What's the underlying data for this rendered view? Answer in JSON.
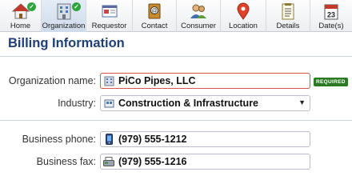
{
  "toolbar": {
    "tabs": [
      {
        "label": "Home",
        "icon": "home-icon",
        "checked": true
      },
      {
        "label": "Organization",
        "icon": "organization-icon",
        "checked": true,
        "active": true
      },
      {
        "label": "Requestor",
        "icon": "requestor-icon"
      },
      {
        "label": "Contact",
        "icon": "contact-icon"
      },
      {
        "label": "Consumer",
        "icon": "consumer-icon"
      },
      {
        "label": "Location",
        "icon": "location-icon"
      },
      {
        "label": "Details",
        "icon": "details-icon"
      },
      {
        "label": "Date(s)",
        "icon": "calendar-icon",
        "calendar_day": "23"
      }
    ]
  },
  "section": {
    "title": "Billing Information"
  },
  "form": {
    "organization": {
      "label": "Organization name:",
      "value": "PiCo Pipes, LLC",
      "badge": "REQUIRED"
    },
    "industry": {
      "label": "Industry:",
      "value": "Construction & Infrastructure"
    },
    "business_phone": {
      "label": "Business phone:",
      "value": "(979) 555-1212"
    },
    "business_fax": {
      "label": "Business fax:",
      "value": "(979) 555-1216"
    }
  },
  "colors": {
    "heading": "#1f3f78",
    "required_border": "#d9534f",
    "badge": "#2a7a22",
    "check": "#2ea53c"
  }
}
